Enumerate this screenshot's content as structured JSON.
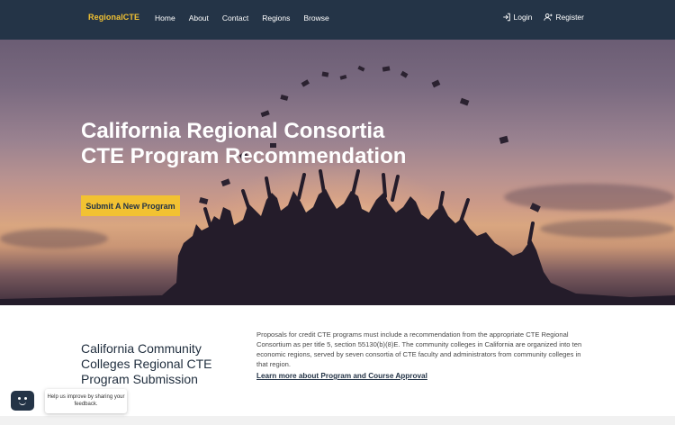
{
  "navbar": {
    "brand": "RegionalCTE",
    "links": [
      "Home",
      "About",
      "Contact",
      "Regions",
      "Browse"
    ],
    "login_label": "Login",
    "register_label": "Register"
  },
  "hero": {
    "title_line1": "California Regional Consortia",
    "title_line2": "CTE Program Recommendation",
    "button_label": "Submit A New Program"
  },
  "section": {
    "title": "California Community Colleges Regional CTE Program Submission",
    "body": "Proposals for credit CTE programs must include a recommendation from the appropriate CTE Regional Consortium as per title 5, section 55130(b)(8)E. The community colleges in California are organized into ten economic regions, served by seven consortia of CTE faculty and administrators from community colleges in that region.",
    "link_label": "Learn more about Program and Course Approval"
  },
  "feedback": {
    "bubble_text": "Help us improve by sharing your feedback."
  },
  "colors": {
    "navbar_bg": "#243447",
    "brand_accent": "#f2c232",
    "button_bg": "#f2c232"
  }
}
